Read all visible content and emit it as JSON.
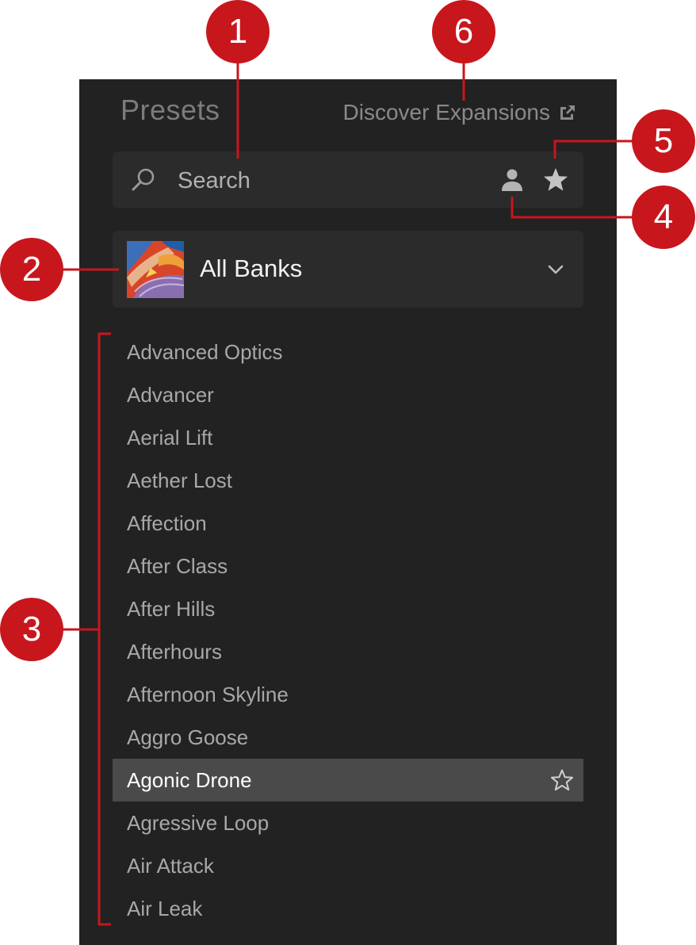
{
  "header": {
    "title": "Presets",
    "discover_label": "Discover Expansions"
  },
  "search": {
    "placeholder": "Search"
  },
  "bank_selector": {
    "label": "All Banks"
  },
  "presets": [
    {
      "name": "Advanced Optics"
    },
    {
      "name": "Advancer"
    },
    {
      "name": "Aerial Lift"
    },
    {
      "name": "Aether Lost"
    },
    {
      "name": "Affection"
    },
    {
      "name": "After Class"
    },
    {
      "name": "After Hills"
    },
    {
      "name": "Afterhours"
    },
    {
      "name": "Afternoon Skyline"
    },
    {
      "name": "Aggro Goose"
    },
    {
      "name": "Agonic Drone"
    },
    {
      "name": "Agressive Loop"
    },
    {
      "name": "Air Attack"
    },
    {
      "name": "Air Leak"
    }
  ],
  "selected_preset": "Agonic Drone",
  "callouts": [
    "1",
    "2",
    "3",
    "4",
    "5",
    "6"
  ],
  "colors": {
    "panel_bg": "#222222",
    "field_bg": "#2b2b2b",
    "selected_row": "#4a4a4a",
    "callout_red": "#c8161d"
  },
  "icons": {
    "search": "search-icon",
    "user": "user-icon",
    "favorites": "star-icon",
    "external_link": "external-link-icon",
    "dropdown": "chevron-down-icon",
    "row_favorite": "star-outline-icon"
  }
}
